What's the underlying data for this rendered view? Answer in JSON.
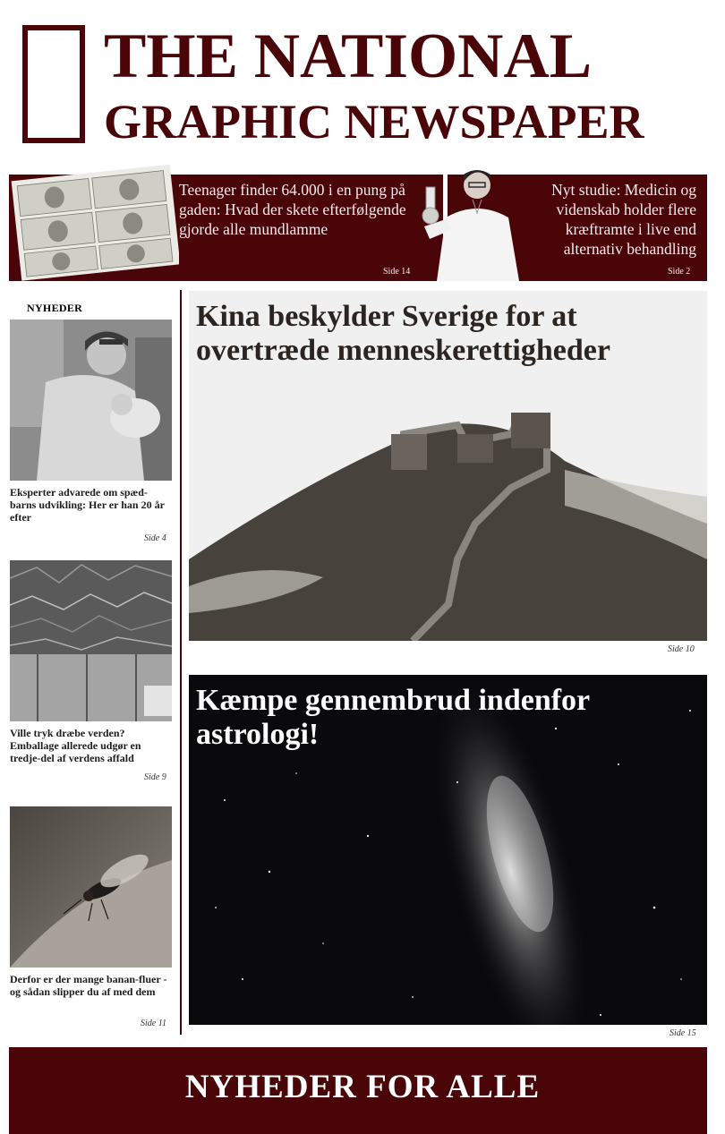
{
  "masthead": {
    "line1": "THE NATIONAL",
    "line2": "GRAPHIC NEWSPAPER"
  },
  "promos": [
    {
      "text": "Teenager finder 64.000 i en pung på gaden: Hvad der skete efterfølgende gjorde alle mundlamme",
      "page": "Side 14"
    },
    {
      "text": "Nyt studie: Medicin og videnskab holder flere kræftramte i live end alternativ behandling",
      "page": "Side 2"
    }
  ],
  "section_label": "NYHEDER",
  "side_stories": [
    {
      "caption": "Eksperter advarede om spæd-barns udvikling: Her er han 20 år efter",
      "page": "Side 4"
    },
    {
      "caption": "Ville tryk dræbe verden? Emballage allerede udgør en tredje-del af verdens affald",
      "page": "Side 9"
    },
    {
      "caption": "Derfor er der mange banan-fluer - og sådan slipper du af med dem",
      "page": "Side 11"
    }
  ],
  "main_stories": [
    {
      "headline": "Kina beskylder Sverige for at overtræde menneskerettigheder",
      "page": "Side 10"
    },
    {
      "headline": "Kæmpe gennembrud indenfor astrologi!",
      "page": "Side 15"
    }
  ],
  "footer": {
    "text": "NYHEDER FOR ALLE"
  },
  "colors": {
    "accent": "#4a0508"
  }
}
